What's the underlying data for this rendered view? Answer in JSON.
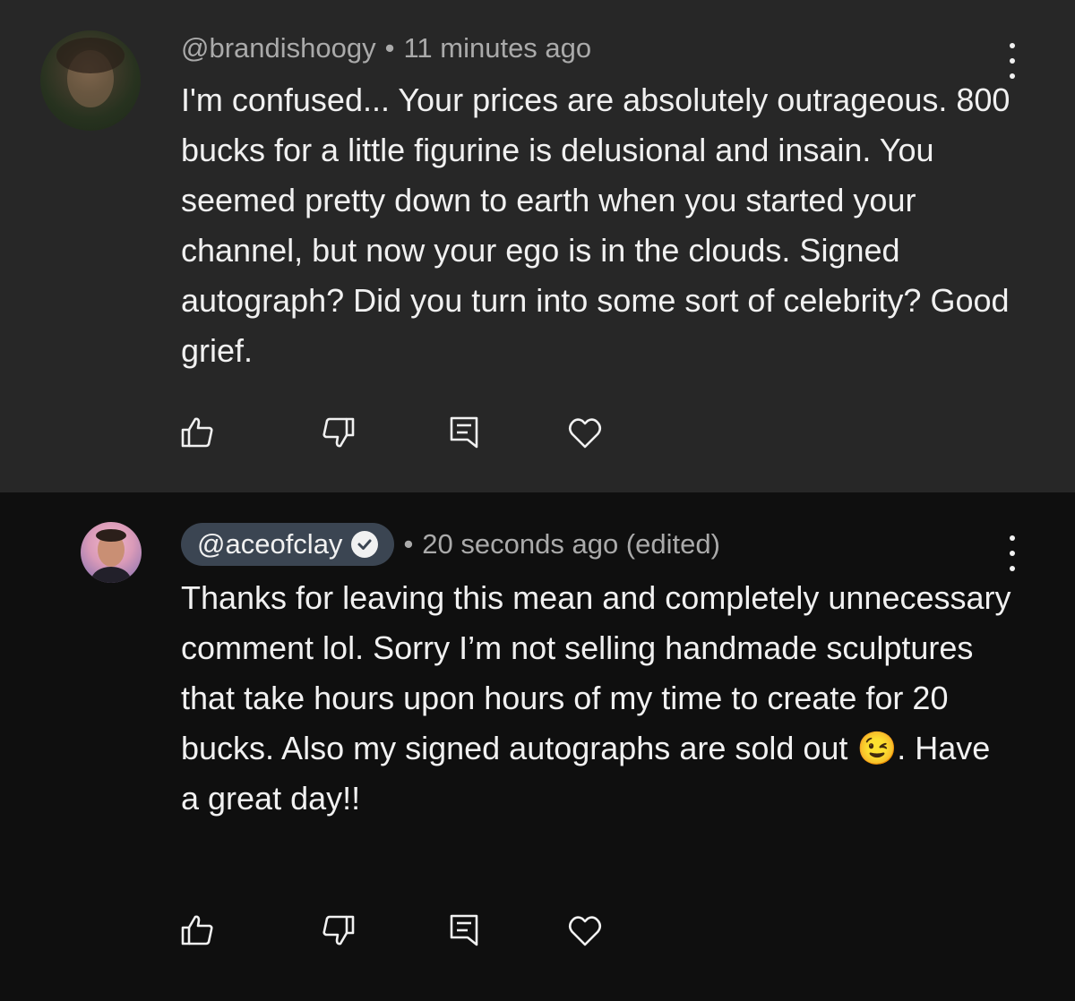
{
  "comments": [
    {
      "author": "@brandishoogy",
      "time": "11 minutes ago",
      "text": "I'm confused... Your prices are absolutely outrageous.  800 bucks for a little figurine is delusional and insain.  You seemed pretty down to earth when you started your channel,  but now your ego is in the clouds.  Signed autograph? Did you turn into some sort of celebrity? Good grief.",
      "is_owner": false
    },
    {
      "author": "@aceofclay",
      "time": "20 seconds ago (edited)",
      "text_before_emoji": "Thanks for leaving this mean and completely unnecessary comment lol. Sorry I’m not selling handmade sculptures that take hours upon hours of my time to create for 20 bucks. Also my signed autographs are sold out ",
      "emoji": "😉",
      "text_after_emoji": ". Have a great day!!",
      "is_owner": true,
      "verified": true
    }
  ],
  "actions": [
    "like-icon",
    "dislike-icon",
    "reply-icon",
    "heart-icon"
  ],
  "dot": "•",
  "colors": {
    "bg_highlighted": "#272727",
    "bg_default": "#0f0f0f",
    "owner_pill": "#3b4552",
    "text": "#f1f1f1",
    "muted": "#aaaaaa"
  }
}
